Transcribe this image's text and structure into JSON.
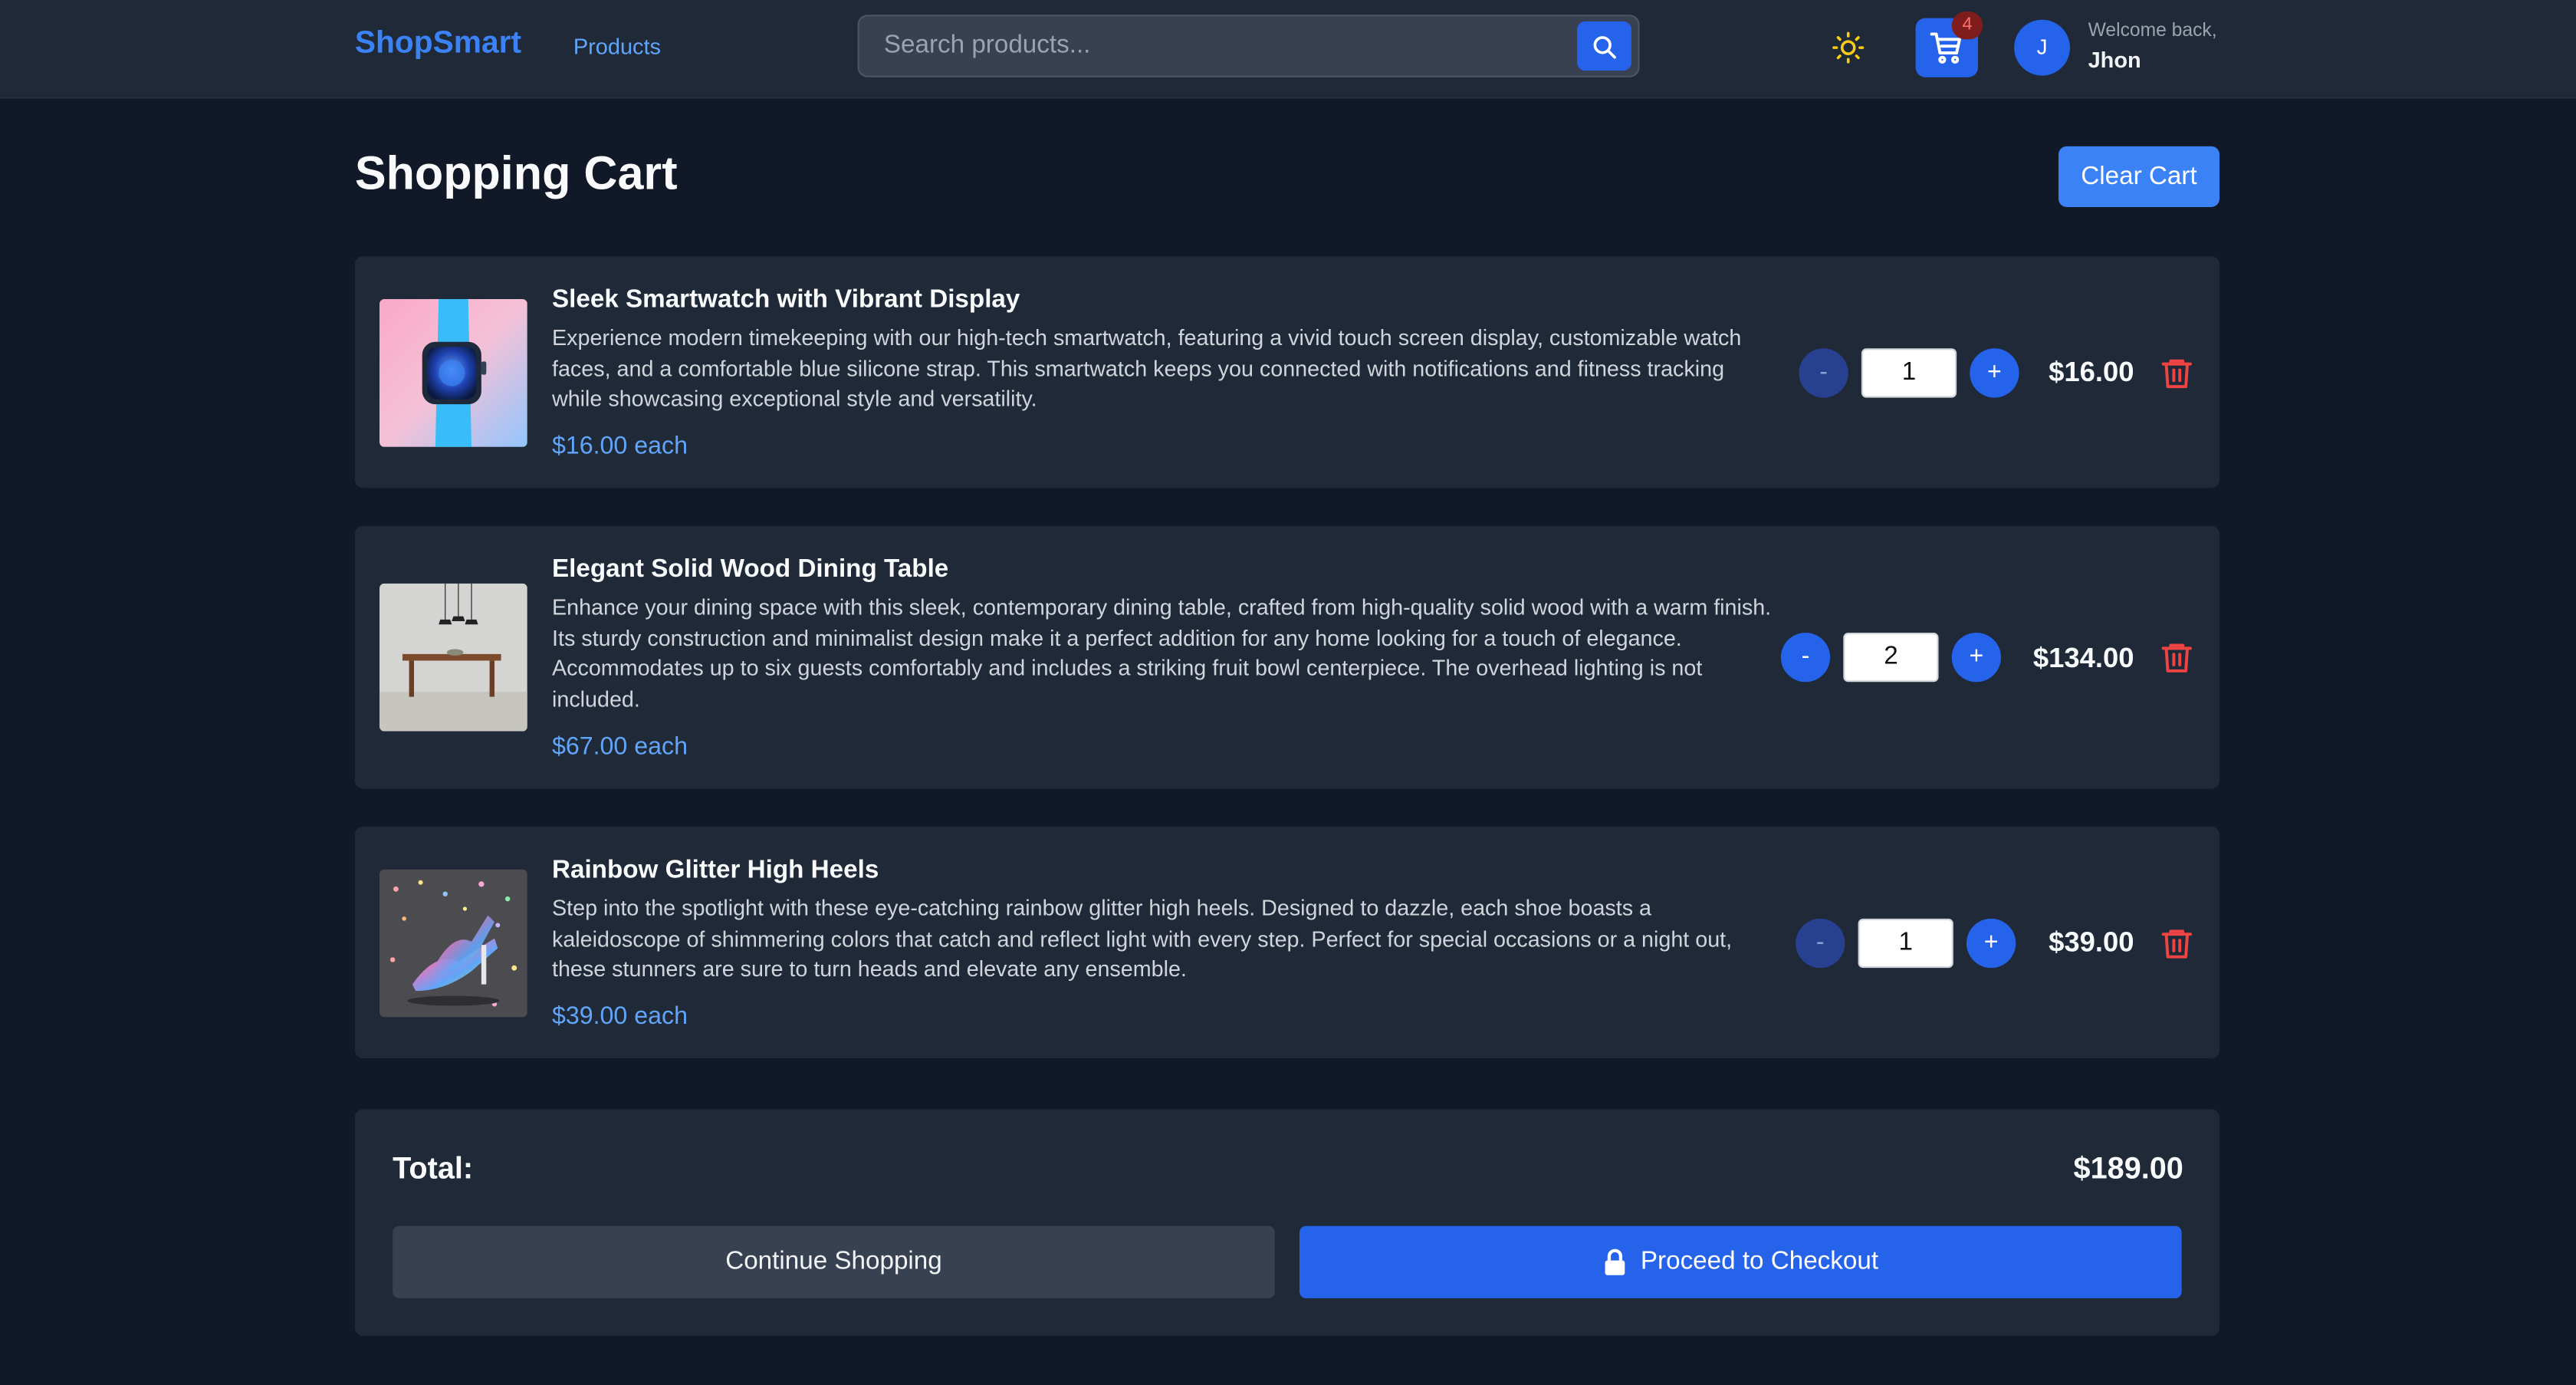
{
  "header": {
    "logo": "ShopSmart",
    "nav_products": "Products",
    "search_placeholder": "Search products...",
    "cart_count": "4",
    "avatar_initial": "J",
    "welcome": "Welcome back,",
    "username": "Jhon"
  },
  "page": {
    "title": "Shopping Cart",
    "clear_cart": "Clear Cart"
  },
  "items": [
    {
      "name": "Sleek Smartwatch with Vibrant Display",
      "description": "Experience modern timekeeping with our high-tech smartwatch, featuring a vivid touch screen display, customizable watch faces, and a comfortable blue silicone strap. This smartwatch keeps you connected with notifications and fitness tracking while showcasing exceptional style and versatility.",
      "unit_price": "$16.00 each",
      "quantity": "1",
      "line_total": "$16.00"
    },
    {
      "name": "Elegant Solid Wood Dining Table",
      "description": "Enhance your dining space with this sleek, contemporary dining table, crafted from high-quality solid wood with a warm finish. Its sturdy construction and minimalist design make it a perfect addition for any home looking for a touch of elegance. Accommodates up to six guests comfortably and includes a striking fruit bowl centerpiece. The overhead lighting is not included.",
      "unit_price": "$67.00 each",
      "quantity": "2",
      "line_total": "$134.00"
    },
    {
      "name": "Rainbow Glitter High Heels",
      "description": "Step into the spotlight with these eye-catching rainbow glitter high heels. Designed to dazzle, each shoe boasts a kaleidoscope of shimmering colors that catch and reflect light with every step. Perfect for special occasions or a night out, these stunners are sure to turn heads and elevate any ensemble.",
      "unit_price": "$39.00 each",
      "quantity": "1",
      "line_total": "$39.00"
    }
  ],
  "summary": {
    "total_label": "Total:",
    "total_value": "$189.00",
    "continue": "Continue Shopping",
    "checkout": "Proceed to Checkout"
  },
  "qty_controls": {
    "minus": "-",
    "plus": "+"
  },
  "colors": {
    "background": "#111827",
    "surface": "#1f2937",
    "accent": "#2563eb",
    "link": "#60a5fa",
    "danger": "#ef4444"
  }
}
